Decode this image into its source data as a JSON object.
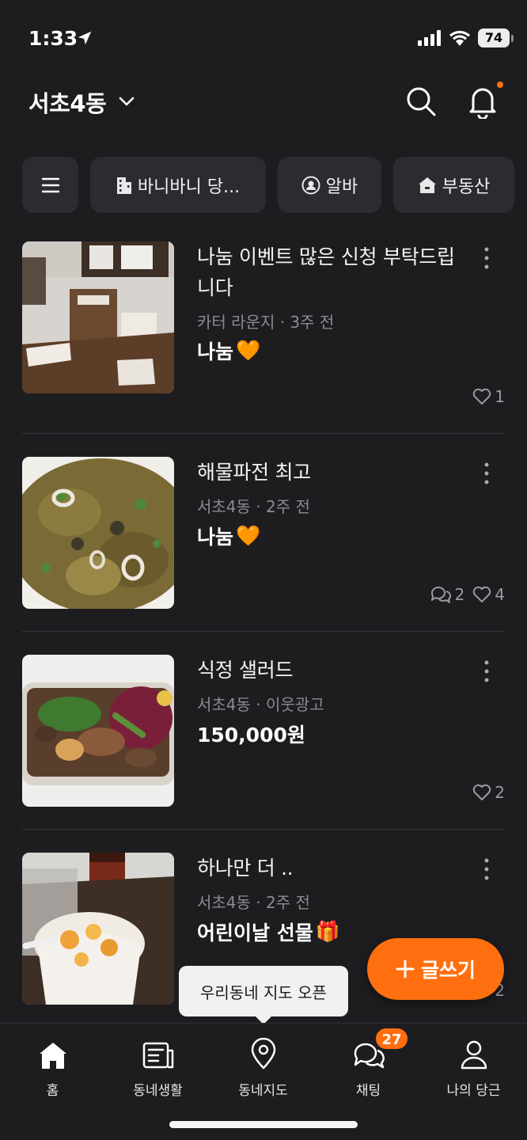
{
  "status": {
    "time": "1:33",
    "battery": "74"
  },
  "header": {
    "location": "서초4동"
  },
  "chips": [
    {
      "label": "",
      "icon": "menu-icon"
    },
    {
      "label": "바니바니 당...",
      "icon": "building-icon"
    },
    {
      "label": "알바",
      "icon": "search-person-icon"
    },
    {
      "label": "부동산",
      "icon": "house-icon"
    }
  ],
  "items": [
    {
      "title": "나눔 이벤트 많은 신청 부탁드립니다",
      "meta": "카터 라운지 · 3주 전",
      "price": "나눔",
      "price_emoji": "🧡",
      "comments": "",
      "likes": "1"
    },
    {
      "title": "해물파전 최고",
      "meta": "서초4동 · 2주 전",
      "price": "나눔",
      "price_emoji": "🧡",
      "comments": "2",
      "likes": "4"
    },
    {
      "title": "식정 샐러드",
      "meta": "서초4동 · 이웃광고",
      "price": "150,000원",
      "price_emoji": "",
      "comments": "",
      "likes": "2"
    },
    {
      "title": "하나만 더 ..",
      "meta": "서초4동 · 2주 전",
      "price": "어린이날 선물",
      "price_emoji": "🎁",
      "comments": "",
      "likes": "2"
    }
  ],
  "fab": {
    "label": "글쓰기"
  },
  "tooltip": {
    "text": "우리동네 지도 오픈"
  },
  "tabs": [
    {
      "label": "홈",
      "icon": "home-icon"
    },
    {
      "label": "동네생활",
      "icon": "newspaper-icon"
    },
    {
      "label": "동네지도",
      "icon": "map-pin-icon"
    },
    {
      "label": "채팅",
      "icon": "chat-icon",
      "badge": "27"
    },
    {
      "label": "나의 당근",
      "icon": "person-icon"
    }
  ],
  "colors": {
    "accent": "#ff6f0f",
    "background": "#1d1d20",
    "chip": "#2b2c31"
  }
}
